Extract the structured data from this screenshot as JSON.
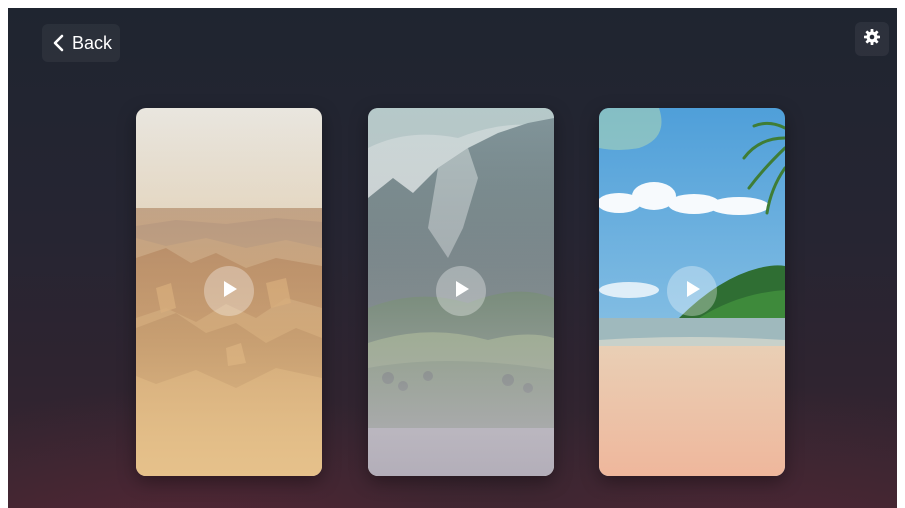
{
  "header": {
    "back_label": "Back",
    "back_icon": "chevron-left-icon",
    "settings_icon": "gear-icon"
  },
  "cards": [
    {
      "scene": "canyon",
      "play_icon": "play-icon"
    },
    {
      "scene": "mountain-valley",
      "play_icon": "play-icon"
    },
    {
      "scene": "tropical-beach",
      "play_icon": "play-icon"
    }
  ],
  "colors": {
    "background_top": "#1f2530",
    "background_bottom": "#3a2630",
    "text": "#ffffff"
  }
}
